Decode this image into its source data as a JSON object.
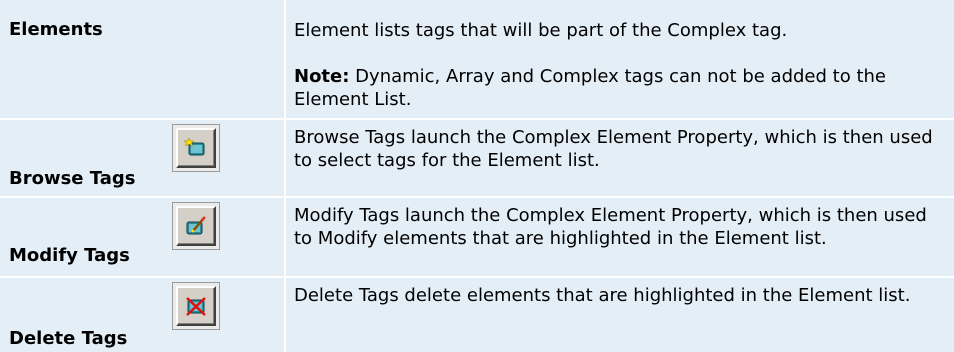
{
  "rows": [
    {
      "label": "Elements",
      "description": "Element lists tags that will be part of the Complex tag.",
      "note_label": "Note:",
      "note_text": " Dynamic, Array and Complex tags can not be added to the Element List."
    },
    {
      "label": "Browse Tags",
      "icon": "browse-tags-icon",
      "description": "Browse Tags launch the Complex Element Property, which is then used to select tags for the Element list."
    },
    {
      "label": "Modify Tags",
      "icon": "modify-tags-icon",
      "description": "Modify Tags launch the Complex Element Property, which is then used to Modify elements that are highlighted in the Element list."
    },
    {
      "label": "Delete Tags",
      "icon": "delete-tags-icon",
      "description": "Delete Tags delete elements that are highlighted in the Element list."
    }
  ]
}
